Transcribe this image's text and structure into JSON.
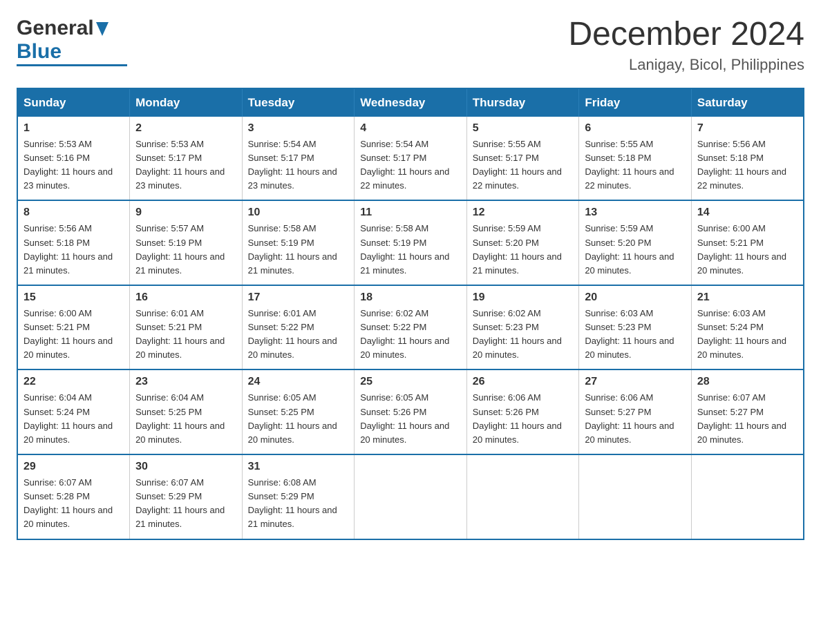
{
  "header": {
    "logo_general": "General",
    "logo_blue": "Blue",
    "month_title": "December 2024",
    "location": "Lanigay, Bicol, Philippines"
  },
  "weekdays": [
    "Sunday",
    "Monday",
    "Tuesday",
    "Wednesday",
    "Thursday",
    "Friday",
    "Saturday"
  ],
  "weeks": [
    [
      {
        "day": "1",
        "sunrise": "Sunrise: 5:53 AM",
        "sunset": "Sunset: 5:16 PM",
        "daylight": "Daylight: 11 hours and 23 minutes."
      },
      {
        "day": "2",
        "sunrise": "Sunrise: 5:53 AM",
        "sunset": "Sunset: 5:17 PM",
        "daylight": "Daylight: 11 hours and 23 minutes."
      },
      {
        "day": "3",
        "sunrise": "Sunrise: 5:54 AM",
        "sunset": "Sunset: 5:17 PM",
        "daylight": "Daylight: 11 hours and 23 minutes."
      },
      {
        "day": "4",
        "sunrise": "Sunrise: 5:54 AM",
        "sunset": "Sunset: 5:17 PM",
        "daylight": "Daylight: 11 hours and 22 minutes."
      },
      {
        "day": "5",
        "sunrise": "Sunrise: 5:55 AM",
        "sunset": "Sunset: 5:17 PM",
        "daylight": "Daylight: 11 hours and 22 minutes."
      },
      {
        "day": "6",
        "sunrise": "Sunrise: 5:55 AM",
        "sunset": "Sunset: 5:18 PM",
        "daylight": "Daylight: 11 hours and 22 minutes."
      },
      {
        "day": "7",
        "sunrise": "Sunrise: 5:56 AM",
        "sunset": "Sunset: 5:18 PM",
        "daylight": "Daylight: 11 hours and 22 minutes."
      }
    ],
    [
      {
        "day": "8",
        "sunrise": "Sunrise: 5:56 AM",
        "sunset": "Sunset: 5:18 PM",
        "daylight": "Daylight: 11 hours and 21 minutes."
      },
      {
        "day": "9",
        "sunrise": "Sunrise: 5:57 AM",
        "sunset": "Sunset: 5:19 PM",
        "daylight": "Daylight: 11 hours and 21 minutes."
      },
      {
        "day": "10",
        "sunrise": "Sunrise: 5:58 AM",
        "sunset": "Sunset: 5:19 PM",
        "daylight": "Daylight: 11 hours and 21 minutes."
      },
      {
        "day": "11",
        "sunrise": "Sunrise: 5:58 AM",
        "sunset": "Sunset: 5:19 PM",
        "daylight": "Daylight: 11 hours and 21 minutes."
      },
      {
        "day": "12",
        "sunrise": "Sunrise: 5:59 AM",
        "sunset": "Sunset: 5:20 PM",
        "daylight": "Daylight: 11 hours and 21 minutes."
      },
      {
        "day": "13",
        "sunrise": "Sunrise: 5:59 AM",
        "sunset": "Sunset: 5:20 PM",
        "daylight": "Daylight: 11 hours and 20 minutes."
      },
      {
        "day": "14",
        "sunrise": "Sunrise: 6:00 AM",
        "sunset": "Sunset: 5:21 PM",
        "daylight": "Daylight: 11 hours and 20 minutes."
      }
    ],
    [
      {
        "day": "15",
        "sunrise": "Sunrise: 6:00 AM",
        "sunset": "Sunset: 5:21 PM",
        "daylight": "Daylight: 11 hours and 20 minutes."
      },
      {
        "day": "16",
        "sunrise": "Sunrise: 6:01 AM",
        "sunset": "Sunset: 5:21 PM",
        "daylight": "Daylight: 11 hours and 20 minutes."
      },
      {
        "day": "17",
        "sunrise": "Sunrise: 6:01 AM",
        "sunset": "Sunset: 5:22 PM",
        "daylight": "Daylight: 11 hours and 20 minutes."
      },
      {
        "day": "18",
        "sunrise": "Sunrise: 6:02 AM",
        "sunset": "Sunset: 5:22 PM",
        "daylight": "Daylight: 11 hours and 20 minutes."
      },
      {
        "day": "19",
        "sunrise": "Sunrise: 6:02 AM",
        "sunset": "Sunset: 5:23 PM",
        "daylight": "Daylight: 11 hours and 20 minutes."
      },
      {
        "day": "20",
        "sunrise": "Sunrise: 6:03 AM",
        "sunset": "Sunset: 5:23 PM",
        "daylight": "Daylight: 11 hours and 20 minutes."
      },
      {
        "day": "21",
        "sunrise": "Sunrise: 6:03 AM",
        "sunset": "Sunset: 5:24 PM",
        "daylight": "Daylight: 11 hours and 20 minutes."
      }
    ],
    [
      {
        "day": "22",
        "sunrise": "Sunrise: 6:04 AM",
        "sunset": "Sunset: 5:24 PM",
        "daylight": "Daylight: 11 hours and 20 minutes."
      },
      {
        "day": "23",
        "sunrise": "Sunrise: 6:04 AM",
        "sunset": "Sunset: 5:25 PM",
        "daylight": "Daylight: 11 hours and 20 minutes."
      },
      {
        "day": "24",
        "sunrise": "Sunrise: 6:05 AM",
        "sunset": "Sunset: 5:25 PM",
        "daylight": "Daylight: 11 hours and 20 minutes."
      },
      {
        "day": "25",
        "sunrise": "Sunrise: 6:05 AM",
        "sunset": "Sunset: 5:26 PM",
        "daylight": "Daylight: 11 hours and 20 minutes."
      },
      {
        "day": "26",
        "sunrise": "Sunrise: 6:06 AM",
        "sunset": "Sunset: 5:26 PM",
        "daylight": "Daylight: 11 hours and 20 minutes."
      },
      {
        "day": "27",
        "sunrise": "Sunrise: 6:06 AM",
        "sunset": "Sunset: 5:27 PM",
        "daylight": "Daylight: 11 hours and 20 minutes."
      },
      {
        "day": "28",
        "sunrise": "Sunrise: 6:07 AM",
        "sunset": "Sunset: 5:27 PM",
        "daylight": "Daylight: 11 hours and 20 minutes."
      }
    ],
    [
      {
        "day": "29",
        "sunrise": "Sunrise: 6:07 AM",
        "sunset": "Sunset: 5:28 PM",
        "daylight": "Daylight: 11 hours and 20 minutes."
      },
      {
        "day": "30",
        "sunrise": "Sunrise: 6:07 AM",
        "sunset": "Sunset: 5:29 PM",
        "daylight": "Daylight: 11 hours and 21 minutes."
      },
      {
        "day": "31",
        "sunrise": "Sunrise: 6:08 AM",
        "sunset": "Sunset: 5:29 PM",
        "daylight": "Daylight: 11 hours and 21 minutes."
      },
      null,
      null,
      null,
      null
    ]
  ]
}
